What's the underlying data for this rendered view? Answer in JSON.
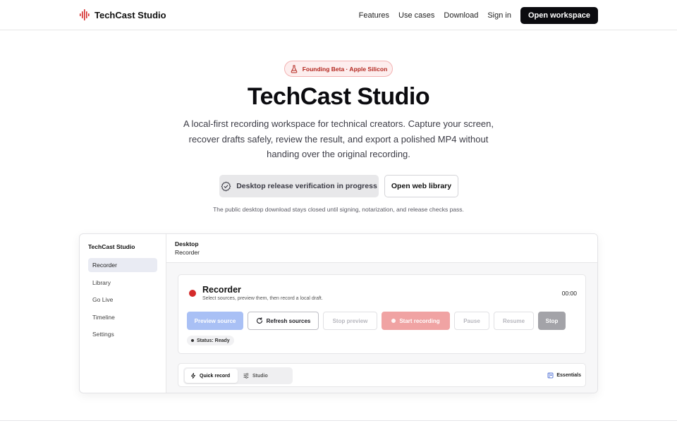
{
  "nav": {
    "brand": "TechCast Studio",
    "links": [
      "Features",
      "Use cases",
      "Download",
      "Sign in"
    ],
    "cta": "Open workspace"
  },
  "hero": {
    "badge": "Founding Beta · Apple Silicon",
    "title": "TechCast Studio",
    "subtitle": "A local-first recording workspace for technical creators. Capture your screen, recover drafts safely, review the result, and export a polished MP4 without handing over the original recording.",
    "primary_button": "Desktop release verification in progress",
    "secondary_button": "Open web library",
    "note": "The public desktop download stays closed until signing, notarization, and release checks pass."
  },
  "app": {
    "sidebar": {
      "title": "TechCast Studio",
      "items": [
        {
          "label": "Recorder",
          "active": true
        },
        {
          "label": "Library"
        },
        {
          "label": "Go Live"
        },
        {
          "label": "Timeline"
        },
        {
          "label": "Settings"
        }
      ]
    },
    "header": {
      "line1": "Desktop",
      "line2": "Recorder"
    },
    "recorder": {
      "title": "Recorder",
      "description": "Select sources, preview them, then record a local draft.",
      "timer": "00:00",
      "buttons": {
        "preview": "Preview source",
        "refresh": "Refresh sources",
        "stop_preview": "Stop preview",
        "start": "Start recording",
        "pause": "Pause",
        "resume": "Resume",
        "stop": "Stop"
      },
      "status": "Status: Ready"
    },
    "modes": {
      "quick": "Quick record",
      "studio": "Studio",
      "essentials": "Essentials"
    }
  },
  "colors": {
    "accent_red": "#d42b2b",
    "primary_dark": "#0b0b0f",
    "preview_blue": "#a9c0f5"
  }
}
